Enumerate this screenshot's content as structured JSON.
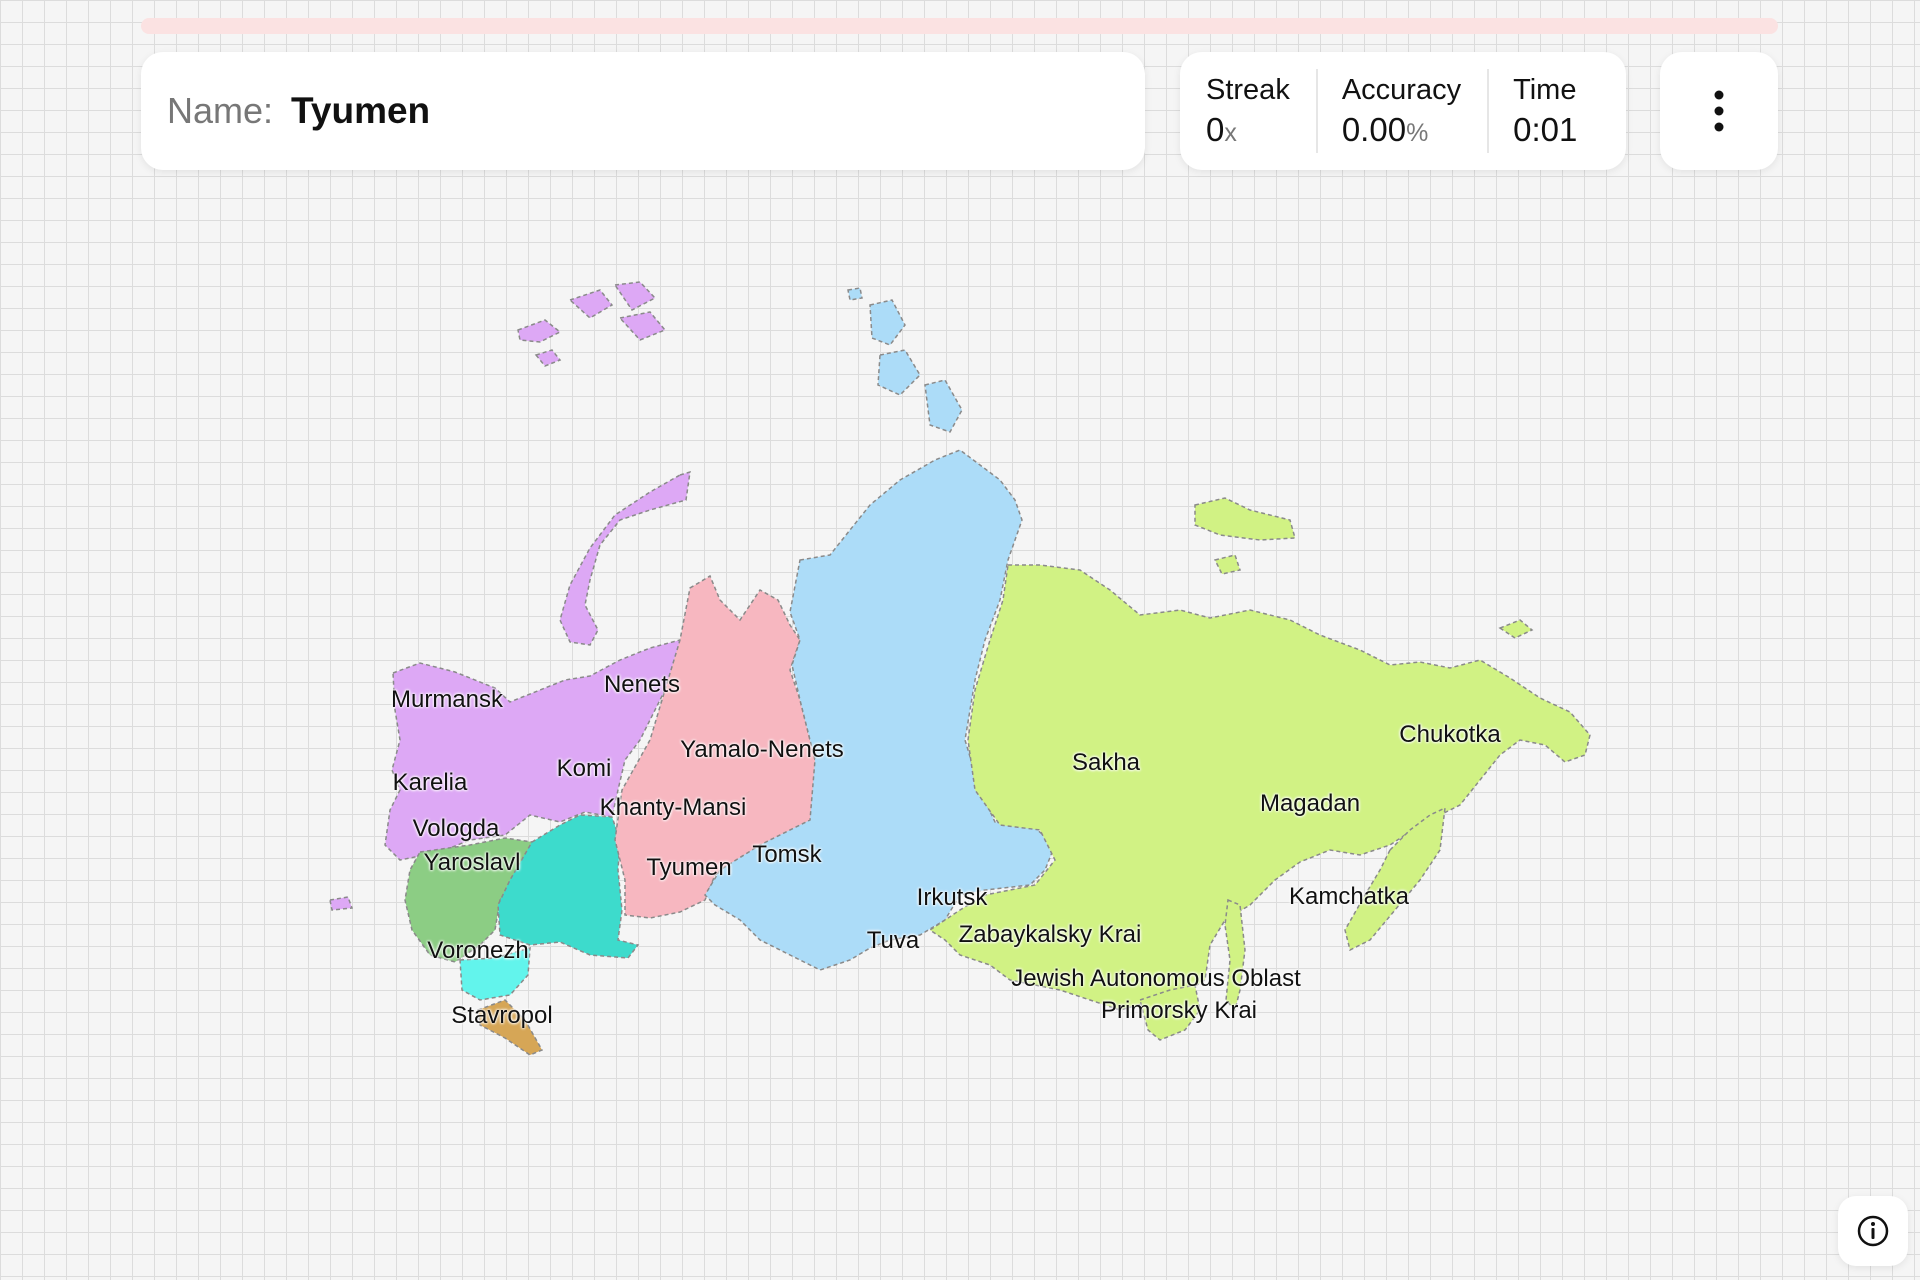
{
  "quiz": {
    "name_label": "Name:",
    "current_region": "Tyumen"
  },
  "stats": {
    "streak_label": "Streak",
    "streak_value": "0",
    "streak_unit": "x",
    "accuracy_label": "Accuracy",
    "accuracy_value": "0.00",
    "accuracy_unit": "%",
    "time_label": "Time",
    "time_value": "0:01"
  },
  "icons": {
    "menu": "more-vertical-icon",
    "info": "info-icon"
  },
  "colors": {
    "progress_track": "#fbe2e2",
    "northwest": "#dda8f5",
    "urals": "#f7b7c0",
    "siberia": "#acdcf8",
    "far_east": "#d1f284",
    "central": "#8ccd84",
    "volga": "#3ddbcc",
    "south": "#62f4ec",
    "north_caucasus": "#d6a656"
  },
  "map": {
    "labels": [
      {
        "key": "murmansk",
        "text": "Murmansk"
      },
      {
        "key": "nenets",
        "text": "Nenets"
      },
      {
        "key": "yamalo-nenets",
        "text": "Yamalo-Nenets"
      },
      {
        "key": "komi",
        "text": "Komi"
      },
      {
        "key": "karelia",
        "text": "Karelia"
      },
      {
        "key": "khanty-mansi",
        "text": "Khanty-Mansi"
      },
      {
        "key": "vologda",
        "text": "Vologda"
      },
      {
        "key": "yaroslavl",
        "text": "Yaroslavl"
      },
      {
        "key": "tomsk",
        "text": "Tomsk"
      },
      {
        "key": "tyumen",
        "text": "Tyumen"
      },
      {
        "key": "voronezh",
        "text": "Voronezh"
      },
      {
        "key": "stavropol",
        "text": "Stavropol"
      },
      {
        "key": "sakha",
        "text": "Sakha"
      },
      {
        "key": "chukotka",
        "text": "Chukotka"
      },
      {
        "key": "magadan",
        "text": "Magadan"
      },
      {
        "key": "kamchatka",
        "text": "Kamchatka"
      },
      {
        "key": "irkutsk",
        "text": "Irkutsk"
      },
      {
        "key": "tuva",
        "text": "Tuva"
      },
      {
        "key": "zabaykalsky",
        "text": "Zabaykalsky Krai"
      },
      {
        "key": "jewish",
        "text": "Jewish Autonomous Oblast"
      },
      {
        "key": "primorsky",
        "text": "Primorsky Krai"
      }
    ]
  }
}
